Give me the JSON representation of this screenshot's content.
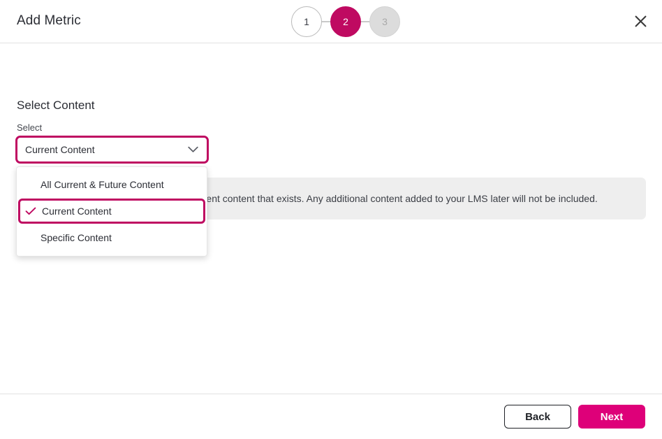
{
  "header": {
    "title": "Add Metric",
    "close_icon": "close-icon",
    "stepper": {
      "steps": [
        {
          "label": "1",
          "state": "complete"
        },
        {
          "label": "2",
          "state": "active"
        },
        {
          "label": "3",
          "state": "disabled"
        }
      ]
    }
  },
  "body": {
    "section_heading": "Select Content",
    "field_label": "Select",
    "select": {
      "value": "Current Content",
      "chevron_icon": "chevron-down-icon",
      "options": [
        {
          "label": "All Current & Future Content",
          "selected": false
        },
        {
          "label": "Current Content",
          "selected": true
        },
        {
          "label": "Specific Content",
          "selected": false
        }
      ],
      "check_icon": "check-icon"
    },
    "info": {
      "text": "This metric will include data from the current content that exists. Any additional content added to your LMS later will not be included."
    }
  },
  "footer": {
    "back_label": "Back",
    "next_label": "Next"
  },
  "colors": {
    "brand_magenta": "#bf0a61",
    "primary_pink": "#de0079",
    "step_disabled": "#dcdcdc",
    "info_background": "#eeeeee",
    "divider": "#e2e2e2"
  }
}
